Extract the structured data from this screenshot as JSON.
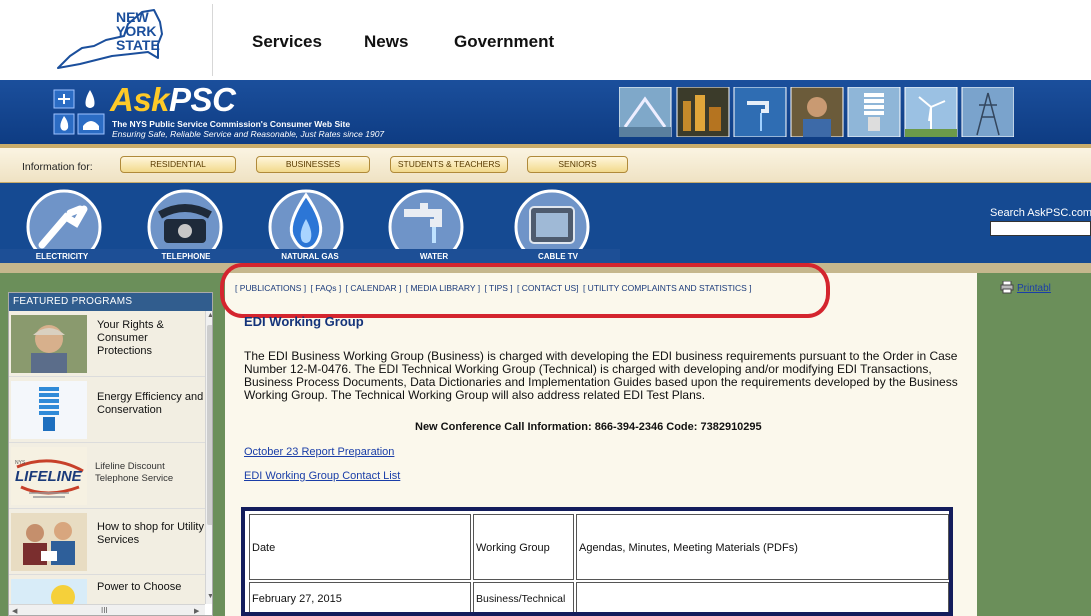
{
  "nys_header": {
    "logo_text": [
      "NEW",
      "YORK",
      "STATE"
    ],
    "nav": [
      "Services",
      "News",
      "Government"
    ]
  },
  "banner": {
    "title_ask": "Ask",
    "title_psc": "PSC",
    "subtitle1": "The NYS Public Service Commission's Consumer Web Site",
    "subtitle2": "Ensuring Safe, Reliable Service and Reasonable, Just Rates since 1907"
  },
  "info_bar": {
    "label": "Information for:",
    "audiences": [
      "RESIDENTIAL",
      "BUSINESSES",
      "STUDENTS & TEACHERS",
      "SENIORS"
    ]
  },
  "utilities": [
    "ELECTRICITY",
    "TELEPHONE",
    "NATURAL GAS",
    "WATER",
    "CABLE TV"
  ],
  "search": {
    "label": "Search AskPSC.com"
  },
  "sub_nav": [
    "[ PUBLICATIONS ]",
    "[ FAQs ]",
    "[ CALENDAR ]",
    "[ MEDIA LIBRARY ]",
    "[ TIPS ]",
    "[ CONTACT  US]",
    "[ UTILITY COMPLAINTS AND STATISTICS ]"
  ],
  "printable": "Printabl",
  "sidebar": {
    "title": "FEATURED PROGRAMS",
    "items": [
      "Your Rights & Consumer Protections",
      "Energy Efficiency and Conservation",
      "Lifeline Discount Telephone Service",
      "How to shop for Utility Services",
      "Power to Choose"
    ],
    "lifeline_badge": "LIFELINE",
    "lifeline_nys": "NYS",
    "scroll_label": "III"
  },
  "main": {
    "heading": "EDI Working Group",
    "body": "The EDI Business Working Group (Business) is charged with developing the EDI business requirements pursuant to the Order in Case Number 12-M-0476. The EDI Technical Working Group (Technical) is charged with developing and/or modifying EDI Transactions, Business Process Documents, Data Dictionaries and Implementation Guides based upon the requirements developed by the Business Working Group. The Technical Working Group will also address related EDI Test Plans.",
    "conf_label": "New Conference Call Information:",
    "conf_value": " 866-394-2346  Code: 7382910295",
    "links": [
      "October 23 Report Preparation",
      "EDI Working Group Contact List"
    ],
    "table": {
      "headers": [
        "Date",
        "Working Group",
        "Agendas, Minutes, Meeting Materials (PDFs)"
      ],
      "rows": [
        [
          "February 27, 2015",
          "Business/Technical",
          ""
        ]
      ]
    }
  },
  "colors": {
    "banner_blue": "#154a92",
    "accent_red": "#d4252e",
    "sidebar_green": "#6b8f5a",
    "link_blue": "#1a3ea8"
  }
}
